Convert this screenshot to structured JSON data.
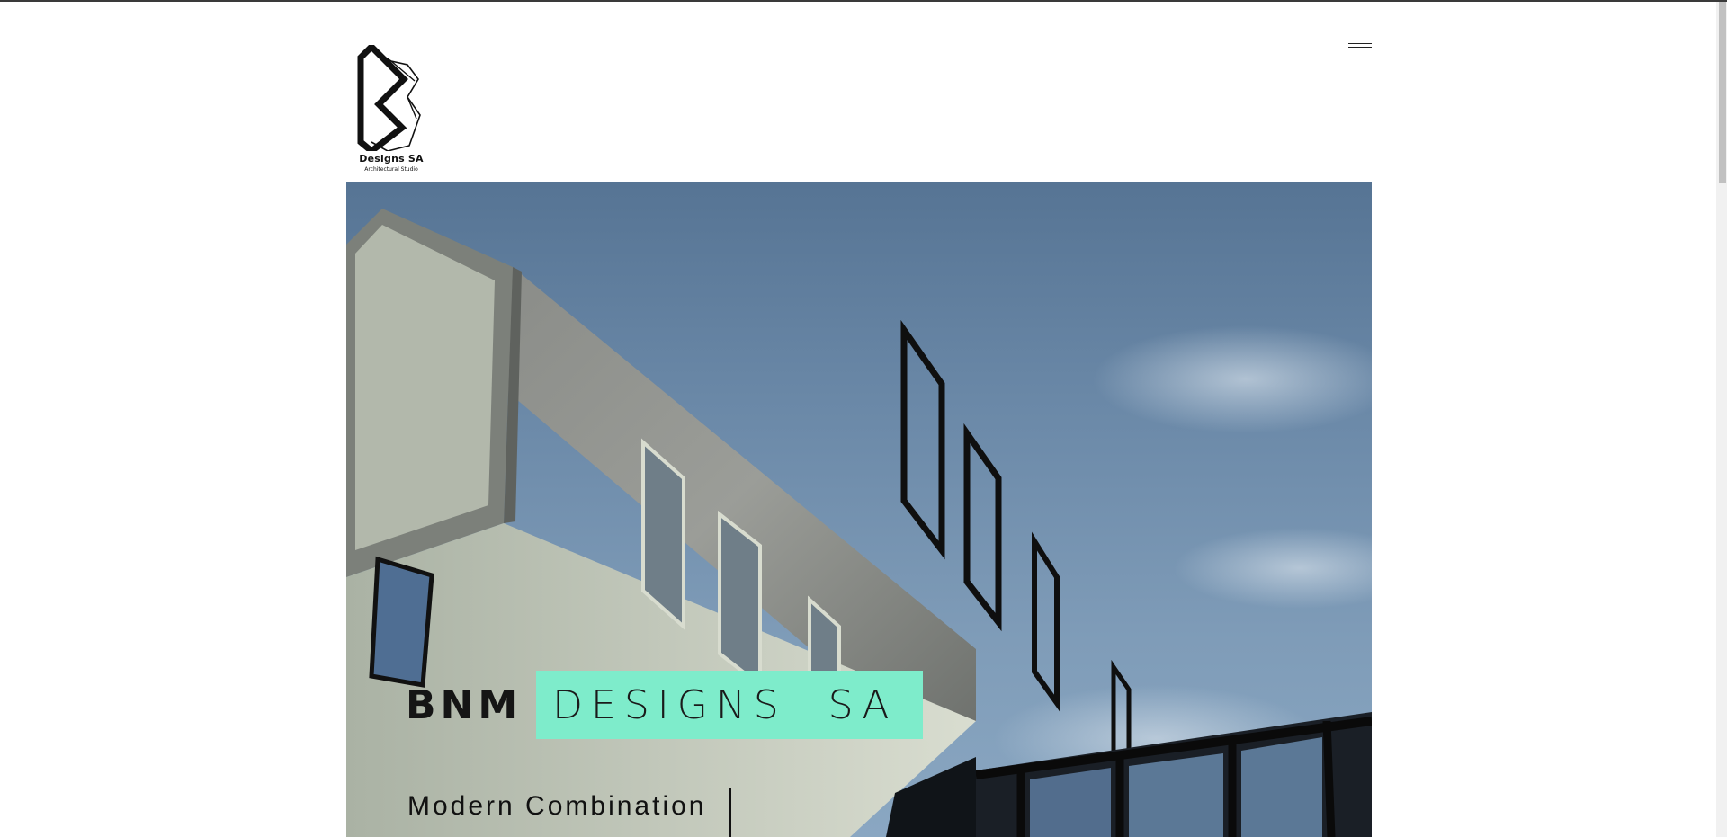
{
  "brand": {
    "name": "Designs SA",
    "subtitle": "Architectural Studio"
  },
  "header": {
    "menu_icon": "hamburger-menu-icon"
  },
  "hero": {
    "title_bold": "BNM",
    "title_highlight": "DESIGNS  SA",
    "subtitle": "Modern Combination",
    "image_icon": "architecture-photo",
    "highlight_color": "#7eeccb"
  }
}
